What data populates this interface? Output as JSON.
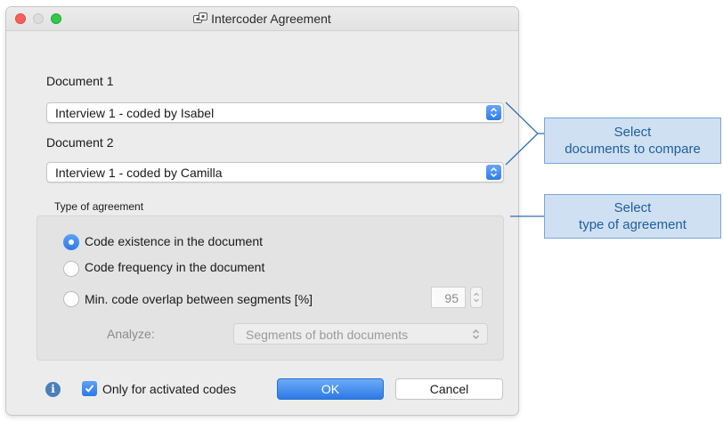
{
  "window": {
    "title": "Intercoder Agreement"
  },
  "document1": {
    "label": "Document 1",
    "value": "Interview 1 - coded by Isabel"
  },
  "document2": {
    "label": "Document 2",
    "value": "Interview 1 - coded by Camilla"
  },
  "agreement": {
    "label": "Type of agreement",
    "options": [
      {
        "label": "Code existence in the document",
        "selected": true
      },
      {
        "label": "Code frequency in the document",
        "selected": false
      },
      {
        "label": "Min. code overlap between segments [%]",
        "selected": false
      }
    ],
    "overlap_value": "95",
    "analyze_label": "Analyze:",
    "analyze_value": "Segments of both documents"
  },
  "footer": {
    "info_glyph": "i",
    "checkbox_label": "Only for activated codes",
    "checkbox_checked": true,
    "ok_label": "OK",
    "cancel_label": "Cancel"
  },
  "callouts": {
    "documents": {
      "line1": "Select",
      "line2": "documents to compare"
    },
    "type": {
      "line1": "Select",
      "line2": "type of agreement"
    }
  },
  "colors": {
    "accent": "#2f7de8",
    "callout_fill": "#cfe0f3",
    "callout_text": "#1f5e9c"
  },
  "icons": {
    "title": "intercoder-agreement-icon",
    "info": "info-icon",
    "checkbox": "checkmark-icon",
    "popup": "chevron-updown-icon"
  }
}
